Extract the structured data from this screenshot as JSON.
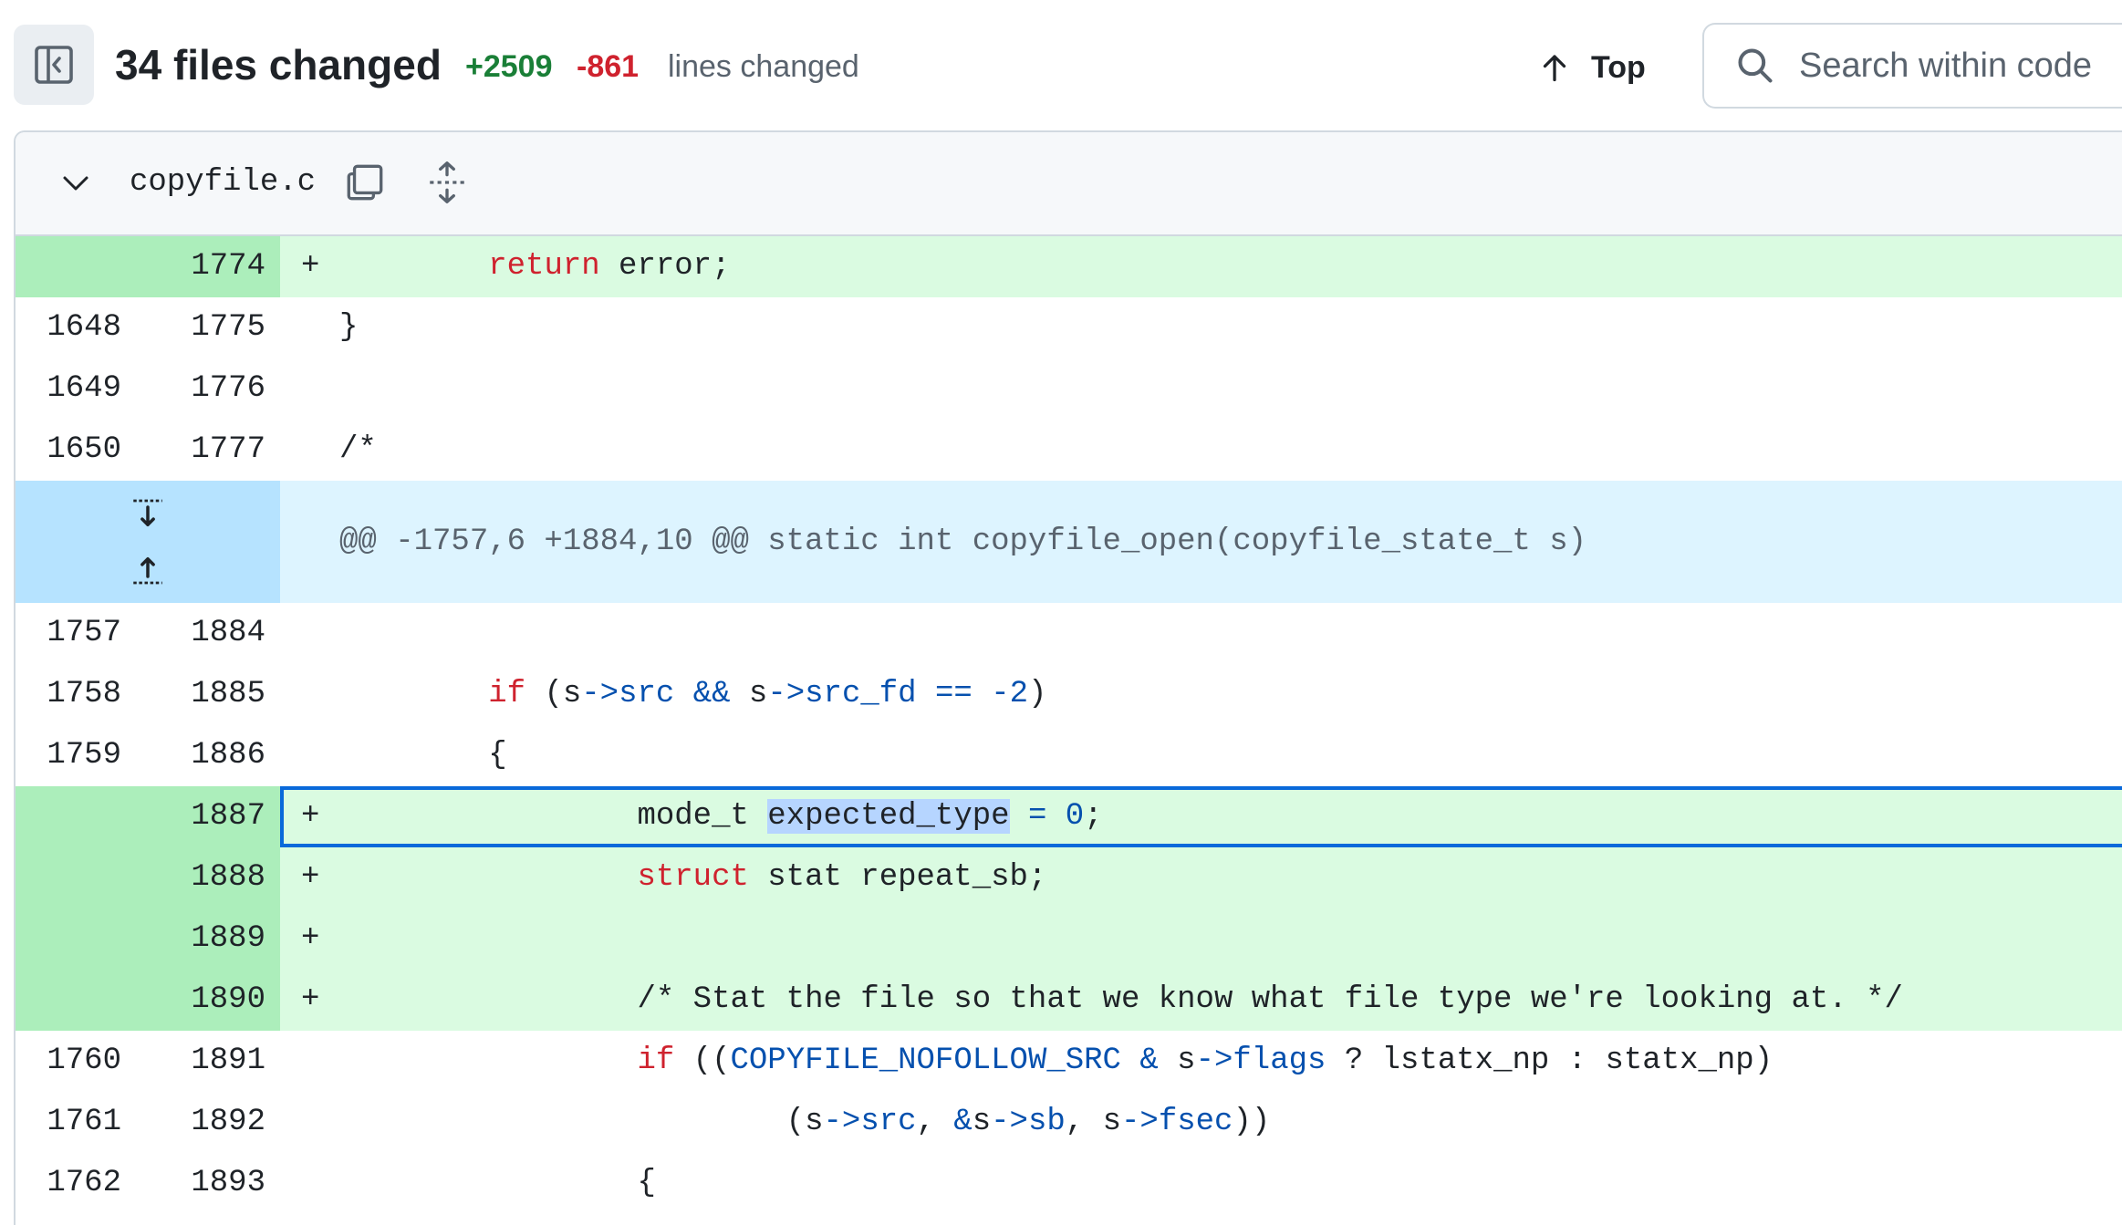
{
  "toolbar": {
    "sidebar_toggle_icon": "sidebar-expand-icon",
    "files_changed": "34 files changed",
    "additions": "+2509",
    "deletions": "-861",
    "lines_changed": "lines changed",
    "top_label": "Top",
    "search_placeholder": "Search within code"
  },
  "file": {
    "name": "copyfile.c",
    "icons": [
      "chevron-down-icon",
      "copy-icon",
      "fold-icon"
    ]
  },
  "rows": [
    {
      "type": "added",
      "old": "",
      "new": "1774",
      "marker": "+",
      "code": "        return error;"
    },
    {
      "type": "context",
      "old": "1648",
      "new": "1775",
      "marker": "",
      "code": "}"
    },
    {
      "type": "context",
      "old": "1649",
      "new": "1776",
      "marker": "",
      "code": ""
    },
    {
      "type": "context",
      "old": "1650",
      "new": "1777",
      "marker": "",
      "code": "/*"
    },
    {
      "type": "hunk",
      "code": "@@ -1757,6 +1884,10 @@ static int copyfile_open(copyfile_state_t s)"
    },
    {
      "type": "context",
      "old": "1757",
      "new": "1884",
      "marker": "",
      "code": ""
    },
    {
      "type": "context",
      "old": "1758",
      "new": "1885",
      "marker": "",
      "code": "        if (s->src && s->src_fd == -2)"
    },
    {
      "type": "context",
      "old": "1759",
      "new": "1886",
      "marker": "",
      "code": "        {"
    },
    {
      "type": "added",
      "old": "",
      "new": "1887",
      "marker": "+",
      "code": "                mode_t expected_type = 0;",
      "selected": true
    },
    {
      "type": "added",
      "old": "",
      "new": "1888",
      "marker": "+",
      "code": "                struct stat repeat_sb;"
    },
    {
      "type": "added",
      "old": "",
      "new": "1889",
      "marker": "+",
      "code": ""
    },
    {
      "type": "added",
      "old": "",
      "new": "1890",
      "marker": "+",
      "code": "                /* Stat the file so that we know what file type we're looking at. */"
    },
    {
      "type": "context",
      "old": "1760",
      "new": "1891",
      "marker": "",
      "code": "                if ((COPYFILE_NOFOLLOW_SRC & s->flags ? lstatx_np : statx_np)"
    },
    {
      "type": "context",
      "old": "1761",
      "new": "1892",
      "marker": "",
      "code": "                        (s->src, &s->sb, s->fsec))"
    },
    {
      "type": "context",
      "old": "1762",
      "new": "1893",
      "marker": "",
      "code": "                {"
    }
  ],
  "colors": {
    "added_bg": "#dafbe1",
    "added_gutter": "#aceebb",
    "hunk_bg": "#ddf4ff",
    "hunk_gutter": "#b6e3ff",
    "keyword": "#cf222e",
    "entity": "#0550ae",
    "selection_border": "#0969da"
  }
}
